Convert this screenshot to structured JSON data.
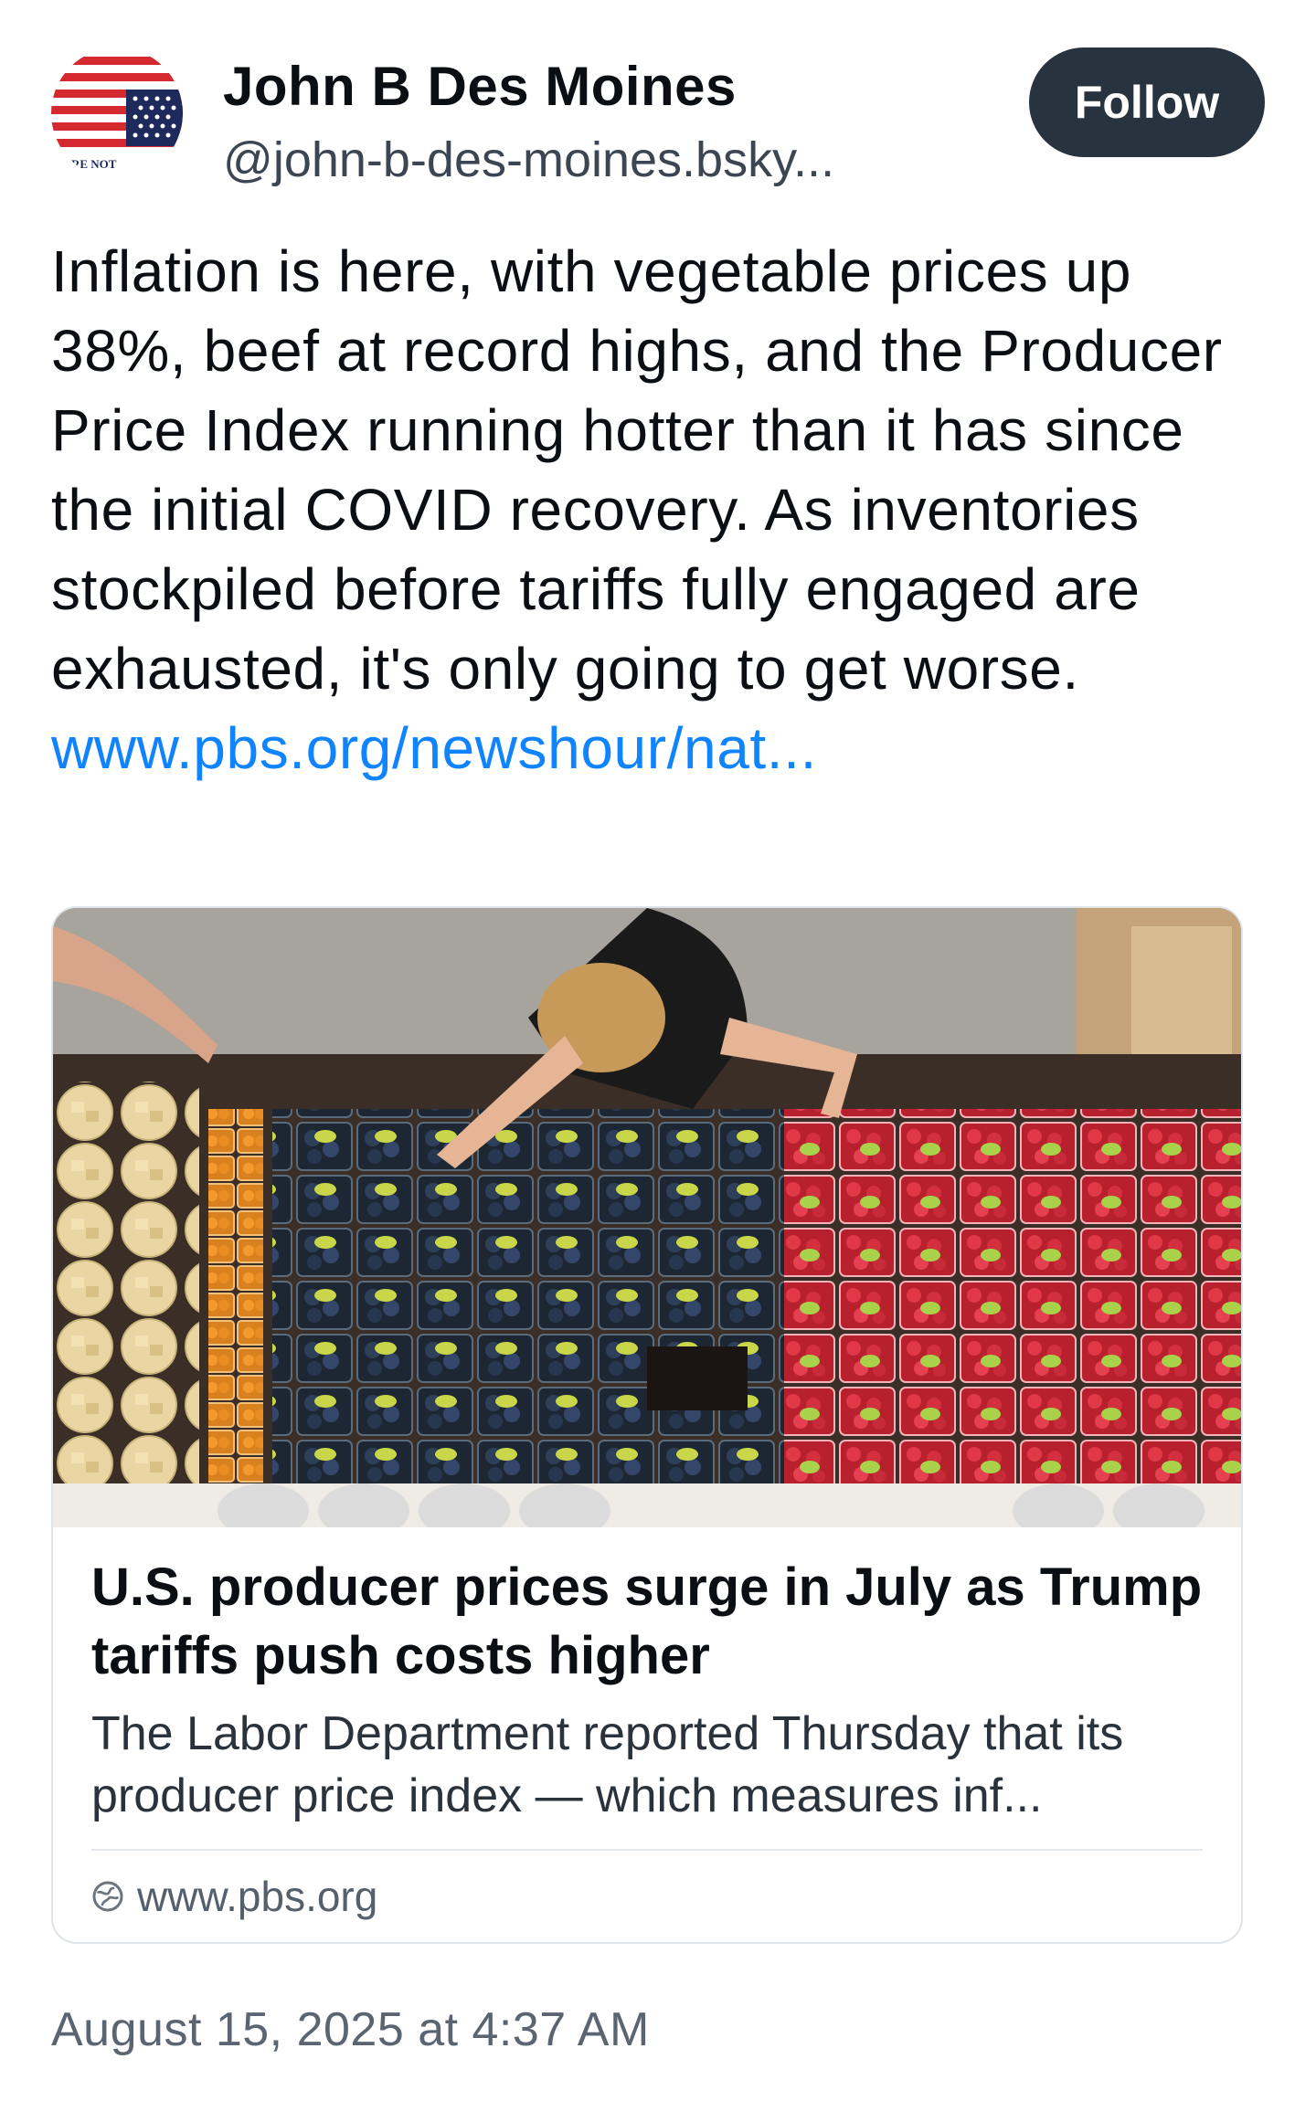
{
  "post": {
    "author": {
      "display_name": "John B Des Moines",
      "handle": "@john-b-des-moines.bsky...",
      "avatar_text": "ARE NOT"
    },
    "follow_label": "Follow",
    "text": "Inflation is here, with vegetable prices up 38%, beef at record highs, and the Producer Price Index running hotter than it has since the initial COVID recovery. As inventories stockpiled before tariffs fully engaged are exhausted, it's only going to get worse.",
    "link_text": "www.pbs.org/newshour/nat...",
    "embed": {
      "image_alt": "Overhead view of a shopper picking berry containers from a grocery produce display",
      "title": "U.S. producer prices surge in July as Trump tariffs push costs higher",
      "description": "The Labor Department reported Thursday that its producer price index — which measures inf...",
      "domain": "www.pbs.org"
    },
    "timestamp": "August 15, 2025 at 4:37 AM"
  },
  "colors": {
    "accent_link": "#1083fe",
    "follow_button_bg": "#27333f",
    "text_primary": "#0b0f14",
    "text_secondary": "#5b6571"
  },
  "icons": [
    "flag-avatar",
    "globe-icon"
  ]
}
